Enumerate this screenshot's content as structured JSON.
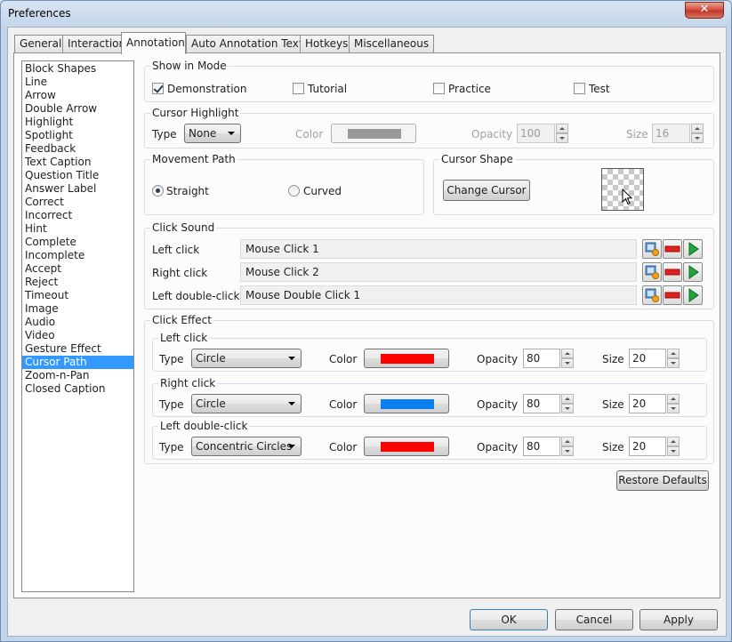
{
  "window": {
    "title": "Preferences",
    "close_glyph": "✕"
  },
  "tabs": [
    {
      "label": "General"
    },
    {
      "label": "Interaction"
    },
    {
      "label": "Annotation",
      "active": true
    },
    {
      "label": "Auto Annotation Text"
    },
    {
      "label": "Hotkeys"
    },
    {
      "label": "Miscellaneous"
    }
  ],
  "list": {
    "selected": "Cursor Path",
    "items": [
      "Block Shapes",
      "Line",
      "Arrow",
      "Double Arrow",
      "Highlight",
      "Spotlight",
      "Feedback",
      "Text Caption",
      "Question Title",
      "Answer Label",
      "Correct",
      "Incorrect",
      "Hint",
      "Complete",
      "Incomplete",
      "Accept",
      "Reject",
      "Timeout",
      "Image",
      "Audio",
      "Video",
      "Gesture Effect",
      "Cursor Path",
      "Zoom-n-Pan",
      "Closed Caption"
    ]
  },
  "show_in_mode": {
    "label": "Show in Mode",
    "demonstration": {
      "label": "Demonstration",
      "checked": true
    },
    "tutorial": {
      "label": "Tutorial",
      "checked": false
    },
    "practice": {
      "label": "Practice",
      "checked": false
    },
    "test": {
      "label": "Test",
      "checked": false
    }
  },
  "cursor_highlight": {
    "label": "Cursor Highlight",
    "type_label": "Type",
    "type_value": "None",
    "color_label": "Color",
    "color": "#999999",
    "opacity_label": "Opacity",
    "opacity_value": "100",
    "size_label": "Size",
    "size_value": "16"
  },
  "movement_path": {
    "label": "Movement Path",
    "straight": {
      "label": "Straight",
      "checked": true
    },
    "curved": {
      "label": "Curved",
      "checked": false
    }
  },
  "cursor_shape": {
    "label": "Cursor Shape",
    "change_button": "Change Cursor",
    "cursor_icon": "arrow-cursor-icon"
  },
  "click_sound": {
    "label": "Click Sound",
    "rows": [
      {
        "label": "Left click",
        "value": "Mouse Click 1"
      },
      {
        "label": "Right click",
        "value": "Mouse Click 2"
      },
      {
        "label": "Left double-click",
        "value": "Mouse Double Click 1"
      }
    ]
  },
  "click_effect": {
    "label": "Click Effect",
    "type_label": "Type",
    "color_label": "Color",
    "opacity_label": "Opacity",
    "size_label": "Size",
    "groups": [
      {
        "label": "Left click",
        "type": "Circle",
        "color": "#ff0000",
        "opacity": "80",
        "size": "20"
      },
      {
        "label": "Right click",
        "type": "Circle",
        "color": "#0a7ff0",
        "opacity": "80",
        "size": "20"
      },
      {
        "label": "Left double-click",
        "type": "Concentric Circles",
        "color": "#ff0000",
        "opacity": "80",
        "size": "20"
      }
    ]
  },
  "buttons": {
    "restore_defaults": "Restore Defaults",
    "ok": "OK",
    "cancel": "Cancel",
    "apply": "Apply"
  }
}
